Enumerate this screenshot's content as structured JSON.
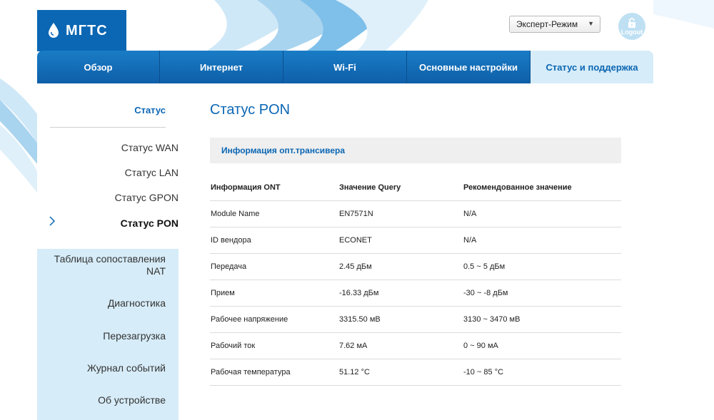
{
  "brand": {
    "logo_text": "МГТС"
  },
  "header": {
    "mode_select": "Эксперт-Режим",
    "logout_label": "Logout"
  },
  "nav": {
    "tabs": [
      {
        "label": "Обзор"
      },
      {
        "label": "Интернет"
      },
      {
        "label": "Wi-Fi"
      },
      {
        "label": "Основные настройки"
      },
      {
        "label": "Статус и поддержка"
      }
    ]
  },
  "sidebar": {
    "section_header": "Статус",
    "sub_items": [
      {
        "label": "Статус WAN"
      },
      {
        "label": "Статус LAN"
      },
      {
        "label": "Статус GPON"
      },
      {
        "label": "Статус PON"
      }
    ],
    "items": [
      {
        "label_line1": "Таблица сопоставления",
        "label_line2": "NAT"
      },
      {
        "label": "Диагностика"
      },
      {
        "label": "Перезагрузка"
      },
      {
        "label": "Журнал событий"
      },
      {
        "label": "Об устройстве"
      }
    ]
  },
  "main": {
    "title": "Статус PON",
    "section_title": "Информация опт.трансивера",
    "table": {
      "headers": [
        "Информация ONT",
        "Значение Query",
        "Рекомендованное значение"
      ],
      "rows": [
        [
          "Module Name",
          "EN7571N",
          "N/A"
        ],
        [
          "ID вендора",
          "ECONET",
          "N/A"
        ],
        [
          "Передача",
          "2.45 дБм",
          "0.5 ~ 5 дБм"
        ],
        [
          "Прием",
          "-16.33 дБм",
          "-30 ~ -8 дБм"
        ],
        [
          "Рабочее напряжение",
          "3315.50 мВ",
          "3130 ~ 3470 мВ"
        ],
        [
          "Рабочий ток",
          "7.62 мА",
          "0 ~ 90 мА"
        ],
        [
          "Рабочая температура",
          "51.12 °C",
          "-10 ~ 85 °C"
        ]
      ]
    }
  },
  "colors": {
    "brand_blue": "#0b66b3",
    "nav_blue": "#1a7cc6",
    "active_tab_bg": "#d6ecf8",
    "sidebar_bg": "#d6ecf8"
  }
}
